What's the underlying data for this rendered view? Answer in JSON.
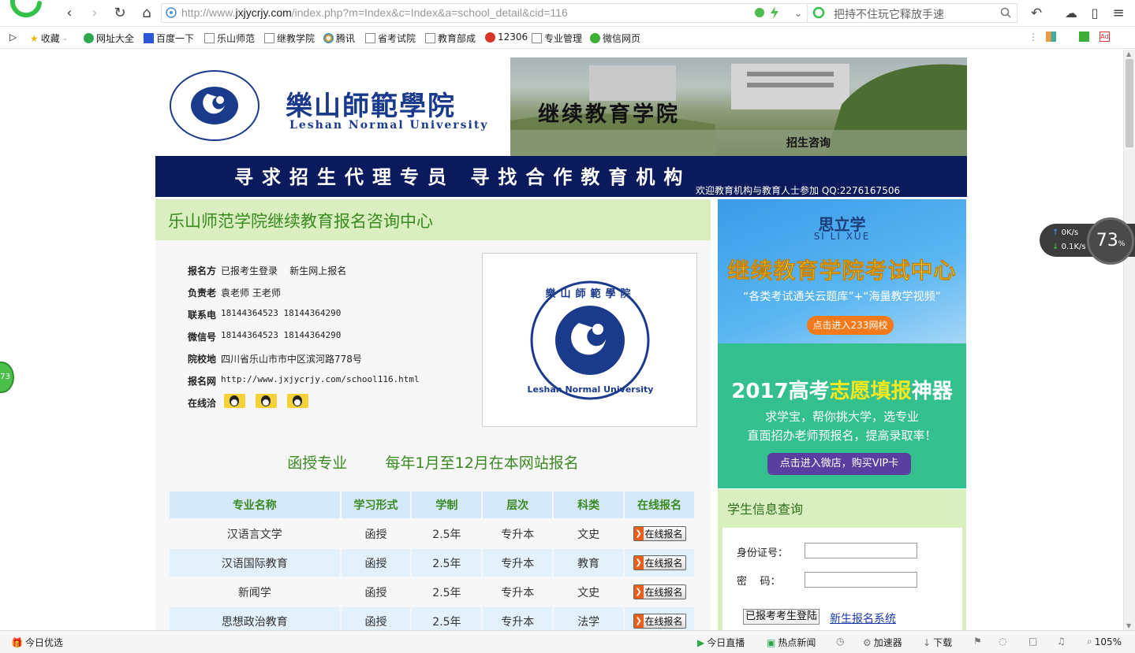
{
  "browser": {
    "url_prefix": "http://www.",
    "url_domain": "jxjycrjy.com",
    "url_rest": "/index.php?m=Index&c=Index&a=school_detail&cid=116",
    "search_placeholder": "把持不住玩它释放手速",
    "bookmarks": [
      "收藏",
      "网址大全",
      "百度一下",
      "乐山师范",
      "继教学院",
      "腾讯",
      "省考试院",
      "教育部成",
      "12306",
      "专业管理",
      "微信网页"
    ],
    "status_items": {
      "left": "今日优选",
      "live": "今日直播",
      "news": "热点新闻",
      "accel": "加速器",
      "download": "下载",
      "zoom": "105%"
    },
    "speed": {
      "up": "0K/s",
      "down": "0.1K/s",
      "percent": "73",
      "percent_unit": "%"
    },
    "side_bubble": "73"
  },
  "banner": {
    "school_cn": "樂山師範學院",
    "school_en": "Leshan Normal University",
    "college": "继续教育学院",
    "consult": "招生咨询"
  },
  "strip": {
    "main": "寻求招生代理专员  寻找合作教育机构",
    "sub": "欢迎教育机构与教育人士参加    QQ:2276167506"
  },
  "center": {
    "title": "乐山师范学院继续教育报名咨询中心",
    "info": [
      {
        "label": "报名方",
        "value": "已报考生登录    新生网上报名"
      },
      {
        "label": "负责老",
        "value": "袁老师 王老师"
      },
      {
        "label": "联系电",
        "value": "18144364523 18144364290"
      },
      {
        "label": "微信号",
        "value": "18144364523 18144364290"
      },
      {
        "label": "院校地",
        "value": "四川省乐山市市中区滨河路778号"
      },
      {
        "label": "报名网",
        "value": "http://www.jxjycrjy.com/school116.html"
      },
      {
        "label": "在线洽",
        "value": ""
      }
    ],
    "logo_cn": "樂山師範學院",
    "logo_en": "Leshan Normal University",
    "major_heading": "函授专业        每年1月至12月在本网站报名",
    "table": {
      "headers": [
        "专业名称",
        "学习形式",
        "学制",
        "层次",
        "科类",
        "在线报名"
      ],
      "rows": [
        [
          "汉语言文学",
          "函授",
          "2.5年",
          "专升本",
          "文史",
          "在线报名"
        ],
        [
          "汉语国际教育",
          "函授",
          "2.5年",
          "专升本",
          "教育",
          "在线报名"
        ],
        [
          "新闻学",
          "函授",
          "2.5年",
          "专升本",
          "文史",
          "在线报名"
        ],
        [
          "思想政治教育",
          "函授",
          "2.5年",
          "专升本",
          "法学",
          "在线报名"
        ]
      ]
    }
  },
  "ads": {
    "ad1": {
      "brand": "思立学",
      "brand_en": "SI LI XUE",
      "headline": "继续教育学院考试中心",
      "tagline": "“各类考试通关云题库”+“海量教学视频”",
      "button": "点击进入233网校"
    },
    "ad2": {
      "headline_a": "2017高考",
      "headline_b": "志愿填报",
      "headline_c": "神器",
      "line1": "求学宝，帮你挑大学，选专业",
      "line2": "直面招办老师预报名，提高录取率！",
      "button": "点击进入微店，购买VIP卡"
    }
  },
  "query": {
    "title": "学生信息查询",
    "id_label": "身份证号：",
    "pwd_label": "密    码：",
    "login_btn": "已报考考生登陆",
    "new_link": "新生报名系统"
  }
}
